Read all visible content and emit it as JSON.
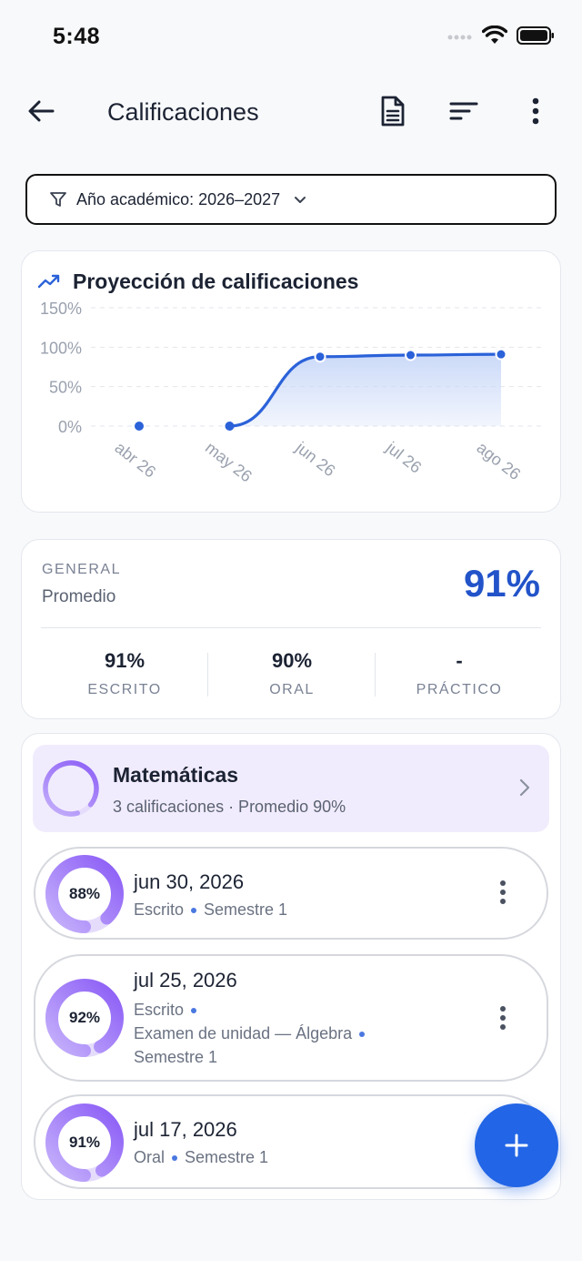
{
  "status_bar": {
    "time": "5:48"
  },
  "header": {
    "title": "Calificaciones"
  },
  "filter": {
    "label": "Año académico: 2026–2027"
  },
  "chart_card": {
    "title": "Proyección de calificaciones"
  },
  "chart_data": {
    "type": "area",
    "title": "Proyección de calificaciones",
    "categories": [
      "abr 26",
      "may 26",
      "jun 26",
      "jul 26",
      "ago 26"
    ],
    "series": [
      {
        "values": [
          0,
          0,
          88,
          90,
          91
        ]
      }
    ],
    "y_ticks": [
      "150%",
      "100%",
      "50%",
      "0%"
    ],
    "ylim": [
      0,
      150
    ],
    "grid": true,
    "colors": {
      "line": "#2b62d9",
      "point": "#2b62d9",
      "fill": "#c9d8f8"
    }
  },
  "summary": {
    "label": "GENERAL",
    "sublabel": "Promedio",
    "value": "91%",
    "stats": [
      {
        "value": "91%",
        "label": "ESCRITO"
      },
      {
        "value": "90%",
        "label": "ORAL"
      },
      {
        "value": "-",
        "label": "PRÁCTICO"
      }
    ]
  },
  "subject": {
    "name": "Matemáticas",
    "meta": "3 calificaciones · Promedio 90%",
    "average": 0.9
  },
  "grades": [
    {
      "percent": "88%",
      "value": 0.88,
      "date": "jun 30, 2026",
      "lines": [
        [
          "Escrito",
          "Semestre 1"
        ]
      ]
    },
    {
      "percent": "92%",
      "value": 0.92,
      "date": "jul 25, 2026",
      "lines": [
        [
          "Escrito"
        ],
        [
          "Examen de unidad — Álgebra"
        ],
        [
          "Semestre 1"
        ]
      ]
    },
    {
      "percent": "91%",
      "value": 0.91,
      "date": "jul 17, 2026",
      "lines": [
        [
          "Oral",
          "Semestre 1"
        ]
      ]
    }
  ],
  "colors": {
    "accent": "#2265e6",
    "ring": "#8b5cf6",
    "ring_track": "#e5dcfc",
    "summary_value": "#2253c9"
  },
  "icons": {
    "back": "arrow-left-icon",
    "report": "document-icon",
    "sort": "sort-icon",
    "more": "more-vertical-icon",
    "filter": "filter-icon",
    "dropdown": "chevron-down-icon",
    "trend": "trending-up-icon",
    "chevron": "chevron-right-icon",
    "fab": "plus-icon"
  }
}
